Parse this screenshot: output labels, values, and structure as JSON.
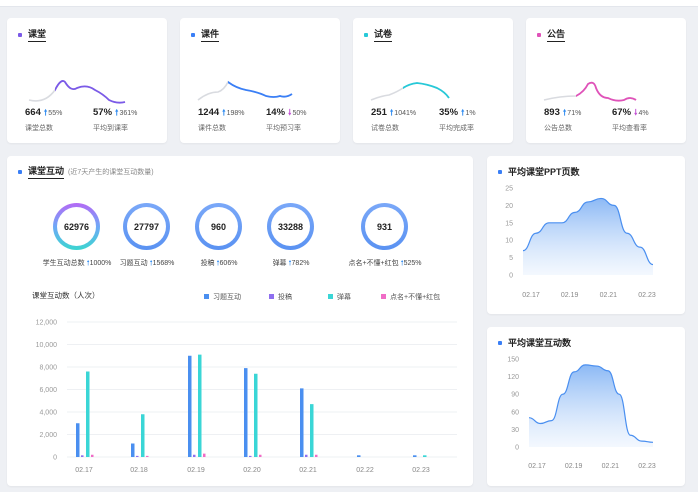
{
  "stat_cards": [
    {
      "title": "课堂",
      "color": "#7b5ae8",
      "stat1_value": "664",
      "stat1_arrow": "🠕",
      "stat1_pct": "55%",
      "stat1_label": "课堂总数",
      "stat2_value": "57%",
      "stat2_arrow": "🠕",
      "stat2_pct": "361%",
      "stat2_label": "平均到课率",
      "spark_color": "#7b5ae8"
    },
    {
      "title": "课件",
      "color": "#3a7ff6",
      "stat1_value": "1244",
      "stat1_arrow": "🠕",
      "stat1_pct": "198%",
      "stat1_label": "课件总数",
      "stat2_value": "14%",
      "stat2_arrow": "🠗",
      "stat2_pct": "50%",
      "stat2_label": "平均预习率",
      "spark_color": "#3a7ff6"
    },
    {
      "title": "试卷",
      "color": "#27c9d8",
      "stat1_value": "251",
      "stat1_arrow": "🠕",
      "stat1_pct": "1041%",
      "stat1_label": "试卷总数",
      "stat2_value": "35%",
      "stat2_arrow": "🠕",
      "stat2_pct": "1%",
      "stat2_label": "平均完成率",
      "spark_color": "#27c9d8"
    },
    {
      "title": "公告",
      "color": "#e052b9",
      "stat1_value": "893",
      "stat1_arrow": "🠕",
      "stat1_pct": "71%",
      "stat1_label": "公告总数",
      "stat2_value": "67%",
      "stat2_arrow": "🠗",
      "stat2_pct": "4%",
      "stat2_label": "平均查看率",
      "spark_color": "#e052b9"
    }
  ],
  "interaction": {
    "title": "课堂互动",
    "subtitle": "(近7天产生的课堂互动数量)",
    "rings": [
      {
        "value": "62976",
        "label": "学生互动总数",
        "pct": "1000%"
      },
      {
        "value": "27797",
        "label": "习题互动",
        "pct": "1568%"
      },
      {
        "value": "960",
        "label": "投稿",
        "pct": "606%"
      },
      {
        "value": "33288",
        "label": "弹幕",
        "pct": "782%"
      },
      {
        "value": "931",
        "label": "点名+不懂+红包",
        "pct": "525%"
      }
    ],
    "arrow": "🠕"
  },
  "chart_data": [
    {
      "type": "bar",
      "title": "课堂互动数（人次）",
      "categories": [
        "02.17",
        "02.18",
        "02.19",
        "02.20",
        "02.21",
        "02.22",
        "02.23"
      ],
      "y_ticks": [
        "12,000",
        "10,000",
        "8,000",
        "6,000",
        "4,000",
        "2,000",
        "0"
      ],
      "ylim": [
        0,
        12000
      ],
      "series": [
        {
          "name": "习题互动",
          "color": "#4a8ff0",
          "values": [
            3000,
            1200,
            9000,
            7900,
            6100,
            150,
            150
          ]
        },
        {
          "name": "投稿",
          "color": "#8e6ff0",
          "values": [
            150,
            100,
            200,
            100,
            200,
            0,
            0
          ]
        },
        {
          "name": "弹幕",
          "color": "#3ad6d6",
          "values": [
            7600,
            3800,
            9100,
            7400,
            4700,
            0,
            150
          ]
        },
        {
          "name": "点名+不懂+红包",
          "color": "#f06cc6",
          "values": [
            200,
            100,
            300,
            200,
            200,
            0,
            0
          ]
        }
      ]
    },
    {
      "type": "area",
      "title": "平均课堂PPT页数",
      "x": [
        "02.17",
        "02.19",
        "02.21",
        "02.23"
      ],
      "y_ticks": [
        "25",
        "20",
        "15",
        "10",
        "5",
        "0"
      ],
      "ylim": [
        0,
        25
      ],
      "values": [
        7,
        12,
        15,
        15,
        18,
        21,
        22,
        20,
        12,
        8,
        3
      ],
      "color": "#4a8ff0"
    },
    {
      "type": "area",
      "title": "平均课堂互动数",
      "x": [
        "02.17",
        "02.19",
        "02.21",
        "02.23"
      ],
      "y_ticks": [
        "150",
        "120",
        "90",
        "60",
        "30",
        "0"
      ],
      "ylim": [
        0,
        150
      ],
      "values": [
        50,
        40,
        45,
        90,
        128,
        140,
        138,
        130,
        90,
        20,
        10,
        8
      ],
      "color": "#4a8ff0"
    }
  ]
}
